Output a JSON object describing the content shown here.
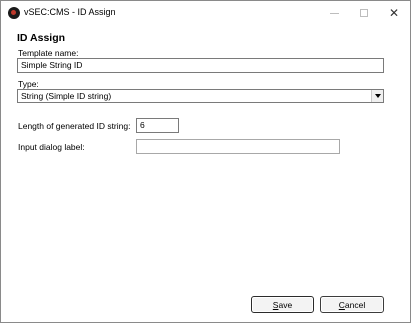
{
  "window": {
    "title": "vSEC:CMS - ID Assign",
    "icon": "vsec-app-icon",
    "controls": [
      "minimize",
      "maximize",
      "close"
    ],
    "close_glyph": "✕"
  },
  "form": {
    "heading": "ID Assign",
    "template_name_label": "Template name:",
    "template_name_value": "Simple String ID",
    "type_label": "Type:",
    "type_value": "String (Simple ID string)",
    "length_label": "Length of generated ID string:",
    "length_value": "6",
    "dialog_label_label": "Input dialog label:",
    "dialog_label_value": ""
  },
  "buttons": {
    "save_label": "Save",
    "cancel_label": "Cancel"
  }
}
